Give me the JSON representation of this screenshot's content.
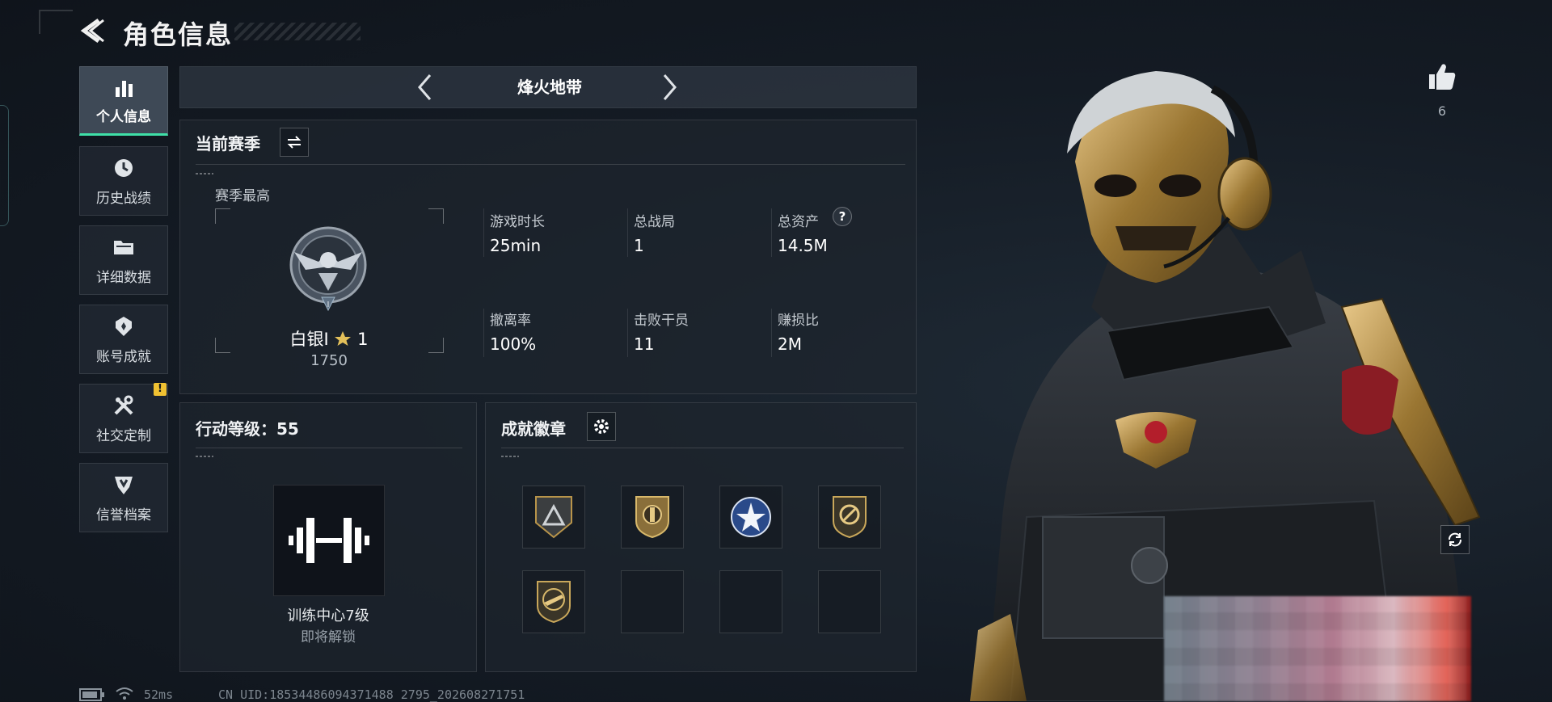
{
  "header": {
    "title": "角色信息"
  },
  "nav": {
    "items": [
      {
        "label": "个人信息",
        "icon": "bar-chart-icon",
        "active": true
      },
      {
        "label": "历史战绩",
        "icon": "clock-history-icon"
      },
      {
        "label": "详细数据",
        "icon": "folder-icon"
      },
      {
        "label": "账号成就",
        "icon": "achievement-icon"
      },
      {
        "label": "社交定制",
        "icon": "tools-icon",
        "alert": "!"
      },
      {
        "label": "信誉档案",
        "icon": "shield-emblem-icon"
      }
    ]
  },
  "mode": {
    "name": "烽火地带"
  },
  "season": {
    "title": "当前赛季",
    "best_label": "赛季最高",
    "rank_name": "白银I",
    "rank_stars": "1",
    "rank_points": "1750",
    "rank_badge_numeral": "I",
    "stats": [
      {
        "label": "游戏时长",
        "value": "25min"
      },
      {
        "label": "总战局",
        "value": "1"
      },
      {
        "label": "总资产",
        "value": "14.5M",
        "help": "?"
      },
      {
        "label": "撤离率",
        "value": "100%"
      },
      {
        "label": "击败干员",
        "value": "11"
      },
      {
        "label": "赚损比",
        "value": "2M"
      }
    ]
  },
  "action_level": {
    "title": "行动等级：55",
    "unlock_name": "训练中心7级",
    "unlock_status": "即将解锁"
  },
  "badges": {
    "title": "成就徽章",
    "slots": [
      {
        "icon": "triangle-shield-badge-icon",
        "filled": true
      },
      {
        "icon": "gold-shield-badge-icon",
        "filled": true
      },
      {
        "icon": "star-crest-badge-icon",
        "filled": true
      },
      {
        "icon": "ring-shield-badge-icon",
        "filled": true
      },
      {
        "icon": "rifle-shield-badge-icon",
        "filled": true
      },
      {
        "filled": false
      },
      {
        "filled": false
      },
      {
        "filled": false
      }
    ]
  },
  "likes": {
    "count": "6"
  },
  "footer": {
    "ping": "52ms",
    "uid": "CN UID:18534486094371488 2795_202608271751"
  },
  "colors": {
    "accent": "#3fe0a8",
    "alert": "#f1c232",
    "gold": "#b8944a"
  }
}
